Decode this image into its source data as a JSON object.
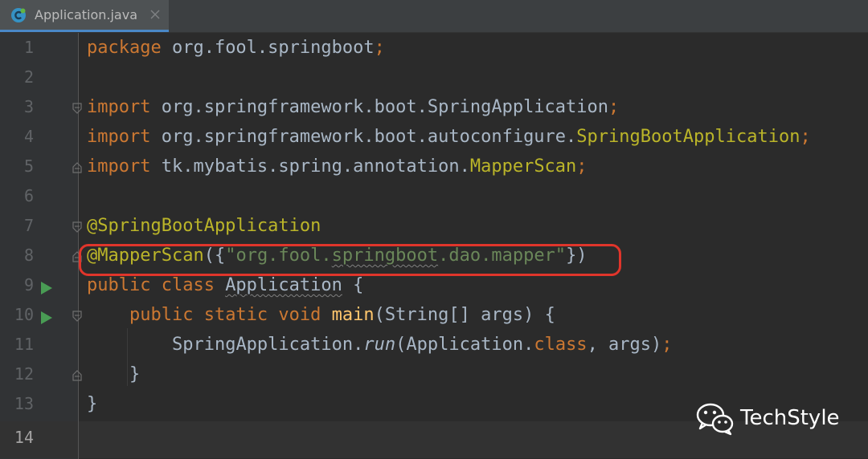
{
  "tab": {
    "label": "Application.java",
    "icon": "java-class-icon",
    "close_icon": "close-icon"
  },
  "colors": {
    "keyword": "#cc7832",
    "annotation": "#bbb529",
    "string": "#6a8759",
    "method": "#ffc66d",
    "text": "#a9b7c6",
    "highlight_box": "#e0352b"
  },
  "line_numbers": [
    "1",
    "2",
    "3",
    "4",
    "5",
    "6",
    "7",
    "8",
    "9",
    "10",
    "11",
    "12",
    "13",
    "14"
  ],
  "current_line": "14",
  "code": {
    "l1": {
      "kw": "package",
      "rest": " org.fool.springboot",
      "semi": ";"
    },
    "l3": {
      "kw": "import",
      "rest": " org.springframework.boot.SpringApplication",
      "semi": ";"
    },
    "l4": {
      "kw": "import",
      "rest": " org.springframework.boot.autoconfigure.",
      "cls": "SpringBootApplication",
      "semi": ";"
    },
    "l5": {
      "kw": "import",
      "rest": " tk.mybatis.spring.annotation.",
      "cls": "MapperScan",
      "semi": ";"
    },
    "l7": {
      "ann": "@SpringBootApplication"
    },
    "l8": {
      "ann": "@MapperScan",
      "open": "({",
      "str_a": "\"org.fool.",
      "str_b": "springboot",
      "str_c": ".dao.mapper\"",
      "close": "})"
    },
    "l9": {
      "kw": "public class ",
      "name": "Application",
      "rest": " {"
    },
    "l10": {
      "indent": "    ",
      "kw": "public static void ",
      "fn": "main",
      "rest": "(String[] args) {"
    },
    "l11": {
      "indent": "        ",
      "pre": "SpringApplication.",
      "it": "run",
      "mid": "(Application.",
      "kw": "class",
      "rest": ", args)",
      "semi": ";"
    },
    "l12": {
      "text": "    }"
    },
    "l13": {
      "text": "}"
    }
  },
  "watermark": {
    "text": "TechStyle",
    "icon": "wechat-icon"
  }
}
